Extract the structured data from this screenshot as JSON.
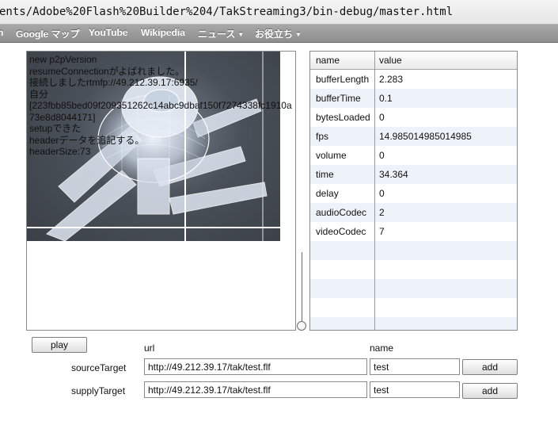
{
  "browser": {
    "url": "ents/Adobe%20Flash%20Builder%204/TakStreaming3/bin-debug/master.html",
    "bookmarks": [
      {
        "label": "n",
        "dropdown": false
      },
      {
        "label": "Google マップ",
        "dropdown": false
      },
      {
        "label": "YouTube",
        "dropdown": false
      },
      {
        "label": "Wikipedia",
        "dropdown": false
      },
      {
        "label": "ニュース",
        "dropdown": true
      },
      {
        "label": "お役立ち",
        "dropdown": true
      }
    ]
  },
  "log": {
    "text": "new p2pVersion\nresumeConnectionがよばれました。\n接続しましたrtmfp://49.212.39.17:6935/\n自分\n[223fbb85bed09f209351262c14abc9dbaf150f7274338fc1910a73e8d8044171]\nsetupできた\nheaderデータを追記する。\nheaderSize:73"
  },
  "stats": {
    "headers": {
      "name": "name",
      "value": "value"
    },
    "rows": [
      {
        "name": "bufferLength",
        "value": "2.283"
      },
      {
        "name": "bufferTime",
        "value": "0.1"
      },
      {
        "name": "bytesLoaded",
        "value": "0"
      },
      {
        "name": "fps",
        "value": "14.985014985014985"
      },
      {
        "name": "volume",
        "value": "0"
      },
      {
        "name": "time",
        "value": "34.364"
      },
      {
        "name": "delay",
        "value": "0"
      },
      {
        "name": "audioCodec",
        "value": "2"
      },
      {
        "name": "videoCodec",
        "value": "7"
      }
    ]
  },
  "controls": {
    "play_label": "play",
    "url_header": "url",
    "name_header": "name",
    "source": {
      "label": "sourceTarget",
      "url": "http://49.212.39.17/tak/test.flf",
      "name": "test",
      "button": "add"
    },
    "supply": {
      "label": "supplyTarget",
      "url": "http://49.212.39.17/tak/test.flf",
      "name": "test",
      "button": "add"
    }
  }
}
